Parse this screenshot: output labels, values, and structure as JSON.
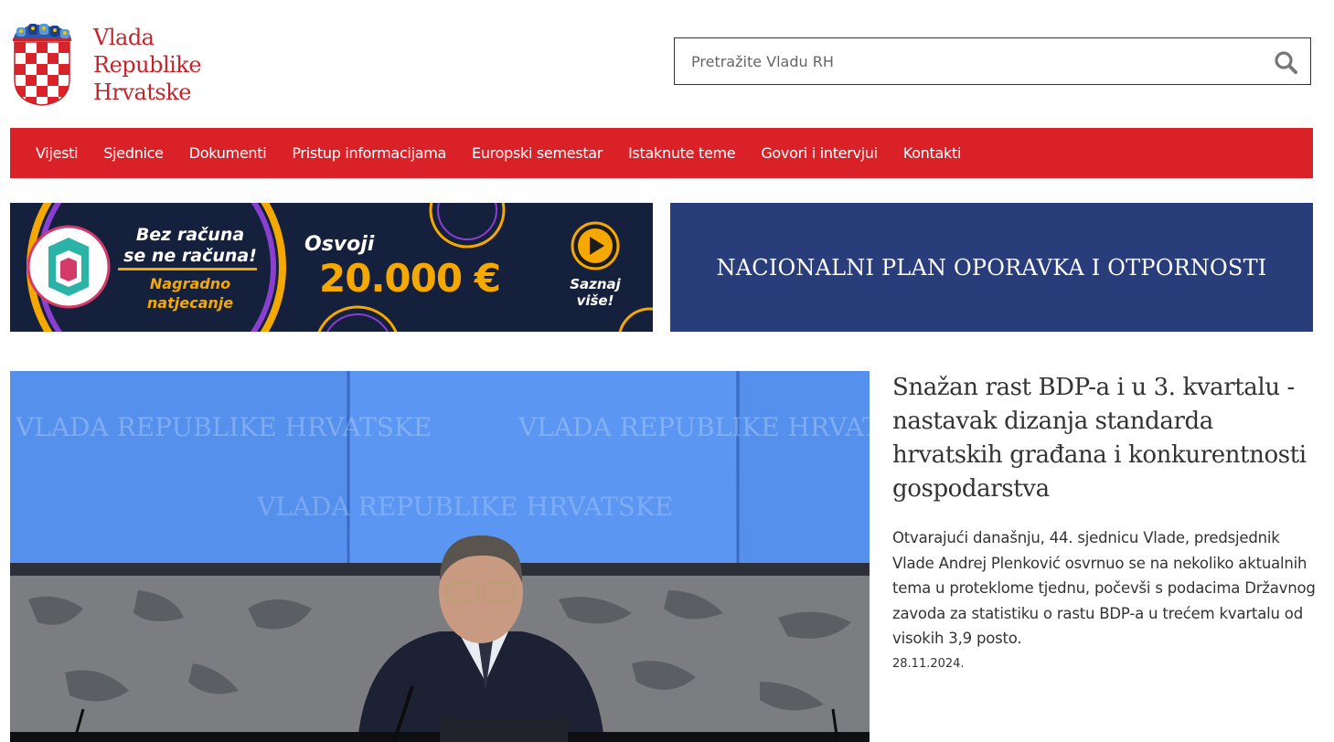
{
  "header": {
    "logo_lines": [
      "Vlada",
      "Republike",
      "Hrvatske"
    ],
    "search_placeholder": "Pretražite Vladu RH",
    "search_icon": "search-icon"
  },
  "nav": {
    "items": [
      {
        "label": "Vijesti"
      },
      {
        "label": "Sjednice"
      },
      {
        "label": "Dokumenti"
      },
      {
        "label": "Pristup informacijama"
      },
      {
        "label": "Europski semestar"
      },
      {
        "label": "Istaknute teme"
      },
      {
        "label": "Govori i intervjui"
      },
      {
        "label": "Kontakti"
      }
    ]
  },
  "banners": {
    "promo": {
      "line1": "Bez računa",
      "line2": "se ne računa!",
      "sub1": "Nagradno",
      "sub2": "natjecanje",
      "prize_label": "Osvoji",
      "prize_amount": "20.000 €",
      "cta1": "Saznaj",
      "cta2": "više!"
    },
    "npoo": {
      "label": "NACIONALNI PLAN OPORAVKA I OTPORNOSTI"
    }
  },
  "feature": {
    "photo_text": "VLADA REPUBLIKE HRVATSKE",
    "headline": "Snažan rast BDP-a i u 3. kvartalu - nastavak dizanja standarda hrvatskih građana i konkurentnosti gospodarstva",
    "summary": "Otvarajući današnju, 44. sjednicu Vlade, predsjednik Vlade Andrej Plenković osvrnuo se na nekoliko aktualnih tema u proteklome tjednu, počevši s podacima Državnog zavoda za statistiku o rastu BDP-a u trećem kvartalu od visokih 3,9 posto.",
    "date": "28.11.2024."
  },
  "colors": {
    "brand_red": "#da2128",
    "logo_red": "#c4242c",
    "npoo_blue": "#283d7a",
    "promo_navy": "#14203c",
    "promo_yellow": "#f5a800"
  }
}
